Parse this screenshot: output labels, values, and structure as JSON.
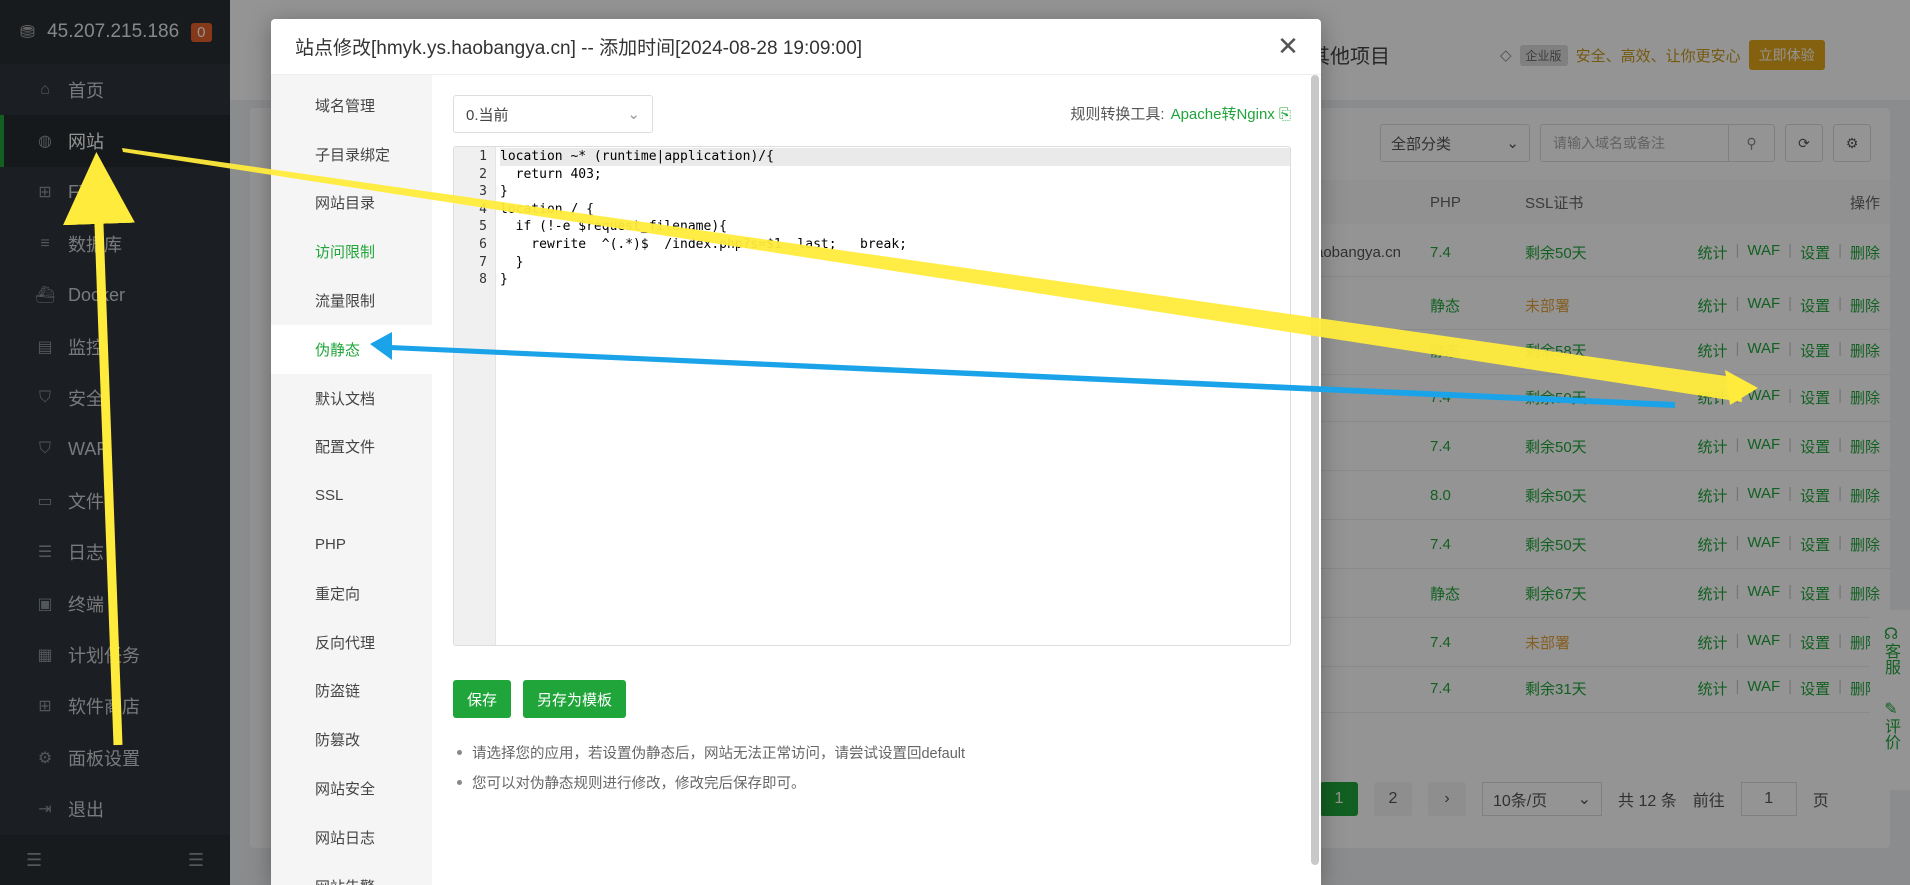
{
  "sidebar": {
    "ip": "45.207.215.186",
    "badge": "0",
    "items": [
      {
        "label": "首页",
        "icon": "home-icon",
        "glyph": "⌂"
      },
      {
        "label": "网站",
        "icon": "globe-icon",
        "glyph": "◍",
        "active": true
      },
      {
        "label": "FTP",
        "icon": "ftp-icon",
        "glyph": "⊞"
      },
      {
        "label": "数据库",
        "icon": "database-icon",
        "glyph": "≡"
      },
      {
        "label": "Docker",
        "icon": "docker-icon",
        "glyph": "⛴"
      },
      {
        "label": "监控",
        "icon": "monitor-icon",
        "glyph": "▤"
      },
      {
        "label": "安全",
        "icon": "shield-icon",
        "glyph": "⛉"
      },
      {
        "label": "WAF",
        "icon": "waf-icon",
        "glyph": "⛉"
      },
      {
        "label": "文件",
        "icon": "folder-icon",
        "glyph": "▭"
      },
      {
        "label": "日志",
        "icon": "log-icon",
        "glyph": "☰"
      },
      {
        "label": "终端",
        "icon": "terminal-icon",
        "glyph": "▣"
      },
      {
        "label": "计划任务",
        "icon": "calendar-icon",
        "glyph": "▦"
      },
      {
        "label": "软件商店",
        "icon": "store-icon",
        "glyph": "⊞"
      },
      {
        "label": "面板设置",
        "icon": "gear-icon",
        "glyph": "⚙"
      },
      {
        "label": "退出",
        "icon": "logout-icon",
        "glyph": "⇥"
      }
    ]
  },
  "background": {
    "other_projects": "其他项目",
    "enterprise_tag": "企业版",
    "slogan": "安全、高效、让你更安心",
    "try_label": "立即体验",
    "category_select": "全部分类",
    "search_placeholder": "请输入域名或备注",
    "headers": {
      "php": "PHP",
      "ssl": "SSL证书",
      "ops": "操作"
    },
    "rows": [
      {
        "domain": "aobangya.cn",
        "php": "7.4",
        "ssl": "剩余50天",
        "ssl_warn": false
      },
      {
        "domain": "",
        "php": "静态",
        "ssl": "未部署",
        "ssl_warn": true
      },
      {
        "domain": "",
        "php": "静态",
        "ssl": "剩余58天",
        "ssl_warn": false
      },
      {
        "domain": "",
        "php": "7.4",
        "ssl": "剩余50天",
        "ssl_warn": false
      },
      {
        "domain": "",
        "php": "7.4",
        "ssl": "剩余50天",
        "ssl_warn": false
      },
      {
        "domain": "",
        "php": "8.0",
        "ssl": "剩余50天",
        "ssl_warn": false
      },
      {
        "domain": "",
        "php": "7.4",
        "ssl": "剩余50天",
        "ssl_warn": false
      },
      {
        "domain": "",
        "php": "静态",
        "ssl": "剩余67天",
        "ssl_warn": false
      },
      {
        "domain": "",
        "php": "7.4",
        "ssl": "未部署",
        "ssl_warn": true
      },
      {
        "domain": "",
        "php": "7.4",
        "ssl": "剩余31天",
        "ssl_warn": false
      }
    ],
    "ops": [
      "统计",
      "WAF",
      "设置",
      "删除"
    ],
    "pager": {
      "page1": "1",
      "page2": "2",
      "next": "›",
      "per_page": "10条/页",
      "total": "共 12 条",
      "goto": "前往",
      "goto_value": "1",
      "page_unit": "页"
    },
    "float": {
      "service": "客服",
      "review": "评价"
    }
  },
  "modal": {
    "title": "站点修改[hmyk.ys.haobangya.cn] -- 添加时间[2024-08-28 19:09:00]",
    "close_glyph": "✕",
    "menu": [
      {
        "label": "域名管理"
      },
      {
        "label": "子目录绑定"
      },
      {
        "label": "网站目录"
      },
      {
        "label": "访问限制",
        "green": true
      },
      {
        "label": "流量限制"
      },
      {
        "label": "伪静态",
        "active": true
      },
      {
        "label": "默认文档"
      },
      {
        "label": "配置文件"
      },
      {
        "label": "SSL"
      },
      {
        "label": "PHP"
      },
      {
        "label": "重定向"
      },
      {
        "label": "反向代理"
      },
      {
        "label": "防盗链"
      },
      {
        "label": "防篡改"
      },
      {
        "label": "网站安全"
      },
      {
        "label": "网站日志"
      },
      {
        "label": "网站告警"
      }
    ],
    "version_select": "0.当前",
    "tool_label": "规则转换工具:",
    "tool_link": "Apache转Nginx",
    "code_lines": [
      "location ~* (runtime|application)/{",
      "  return 403;",
      "}",
      "location / {",
      "  if (!-e $request_filename){",
      "    rewrite  ^(.*)$  /index.php?s=$1  last;   break;",
      "  }",
      "}"
    ],
    "save_label": "保存",
    "save_template_label": "另存为模板",
    "tips": [
      "请选择您的应用，若设置伪静态后，网站无法正常访问，请尝试设置回default",
      "您可以对伪静态规则进行修改，修改完后保存即可。"
    ]
  },
  "colors": {
    "accent": "#20a53a",
    "arrow_yellow": "#ffeb3b",
    "arrow_blue": "#1aa3e8"
  }
}
